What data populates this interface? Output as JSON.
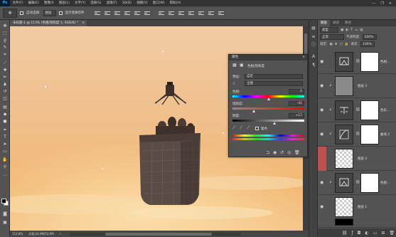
{
  "menu": {
    "logo": "Ps",
    "items": [
      "文件(F)",
      "编辑(E)",
      "图像(I)",
      "图层(L)",
      "文字(Y)",
      "选择(S)",
      "滤镜(T)",
      "3D(D)",
      "视图(V)",
      "窗口(W)",
      "帮助(H)"
    ],
    "window_controls": [
      "—",
      "❐",
      "✕"
    ]
  },
  "options": {
    "tool_icon": "move-tool-icon",
    "auto_select_label": "自动选择:",
    "auto_select_target": "图层",
    "show_transform_label": "显示变换控件"
  },
  "document": {
    "tab_title": "未标题-1 @ 113% (色相/饱和度 1, RGB/8) *",
    "close": "×"
  },
  "status": {
    "zoom": "112.8%",
    "doc_size": "文档:24.6M/53.9M"
  },
  "properties": {
    "title": "属性",
    "close": "×",
    "layer_type": "色相/饱和度",
    "preset_label": "预设:",
    "preset_value": "自定",
    "channel_value": "全图",
    "hue_label": "色相:",
    "hue_value": "0",
    "hue_level": 0,
    "saturation_label": "饱和度:",
    "saturation_value": "-41",
    "saturation_level": -41,
    "lightness_label": "明度:",
    "lightness_value": "+17",
    "lightness_level": 17,
    "colorize_label": "着色"
  },
  "layers_panel": {
    "tabs": [
      "图层",
      "通道",
      "路径"
    ],
    "kind_filter": "类型",
    "blend_mode": "正常",
    "opacity_label": "不透明度:",
    "opacity_value": "100%",
    "lock_label": "锁定:",
    "fill_label": "填充:",
    "fill_value": "100%",
    "layers": [
      {
        "name": "色相...",
        "kind": "adjustment"
      },
      {
        "name": "图层 3",
        "kind": "pixel"
      },
      {
        "name": "色彩...",
        "kind": "adjustment"
      },
      {
        "name": "曲线 2",
        "kind": "adjustment"
      },
      {
        "name": "图层 2",
        "kind": "pixel"
      },
      {
        "name": "色相...",
        "kind": "adjustment"
      },
      {
        "name": "图层 1",
        "kind": "pixel"
      }
    ]
  },
  "colors": {
    "sky_top": "#f0c89c",
    "sky_bottom": "#f2b66e",
    "accent_red": "#c0504d"
  }
}
